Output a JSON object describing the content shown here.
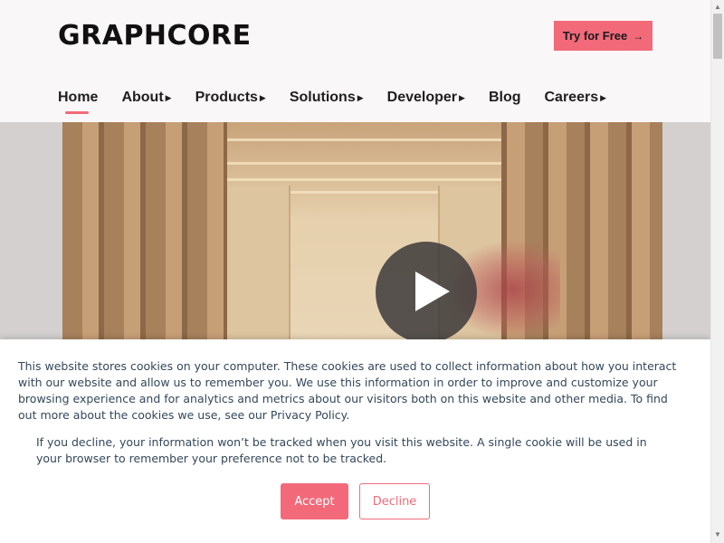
{
  "header": {
    "logo_text": "GRAPHCORE",
    "cta_label": "Try for Free",
    "cta_arrow": "→"
  },
  "nav": {
    "items": [
      {
        "label": "Home",
        "has_submenu": false,
        "active": true
      },
      {
        "label": "About",
        "has_submenu": true,
        "active": false
      },
      {
        "label": "Products",
        "has_submenu": true,
        "active": false
      },
      {
        "label": "Solutions",
        "has_submenu": true,
        "active": false
      },
      {
        "label": "Developer",
        "has_submenu": true,
        "active": false
      },
      {
        "label": "Blog",
        "has_submenu": false,
        "active": false
      },
      {
        "label": "Careers",
        "has_submenu": true,
        "active": false
      }
    ],
    "caret": "▶"
  },
  "hero": {
    "play_icon": "play-icon"
  },
  "cookie_banner": {
    "text1": "This website stores cookies on your computer. These cookies are used to collect information about how you interact with our website and allow us to remember you. We use this information in order to improve and customize your browsing experience and for analytics and metrics about our visitors both on this website and other media. To find out more about the cookies we use, see our Privacy Policy.",
    "text2": "If you decline, your information won’t be tracked when you visit this website. A single cookie will be used in your browser to remember your preference not to be tracked.",
    "accept_label": "Accept",
    "decline_label": "Decline"
  },
  "colors": {
    "accent": "#f26a7a",
    "header_bg": "#faf7f8",
    "cookie_text": "#33475b"
  }
}
